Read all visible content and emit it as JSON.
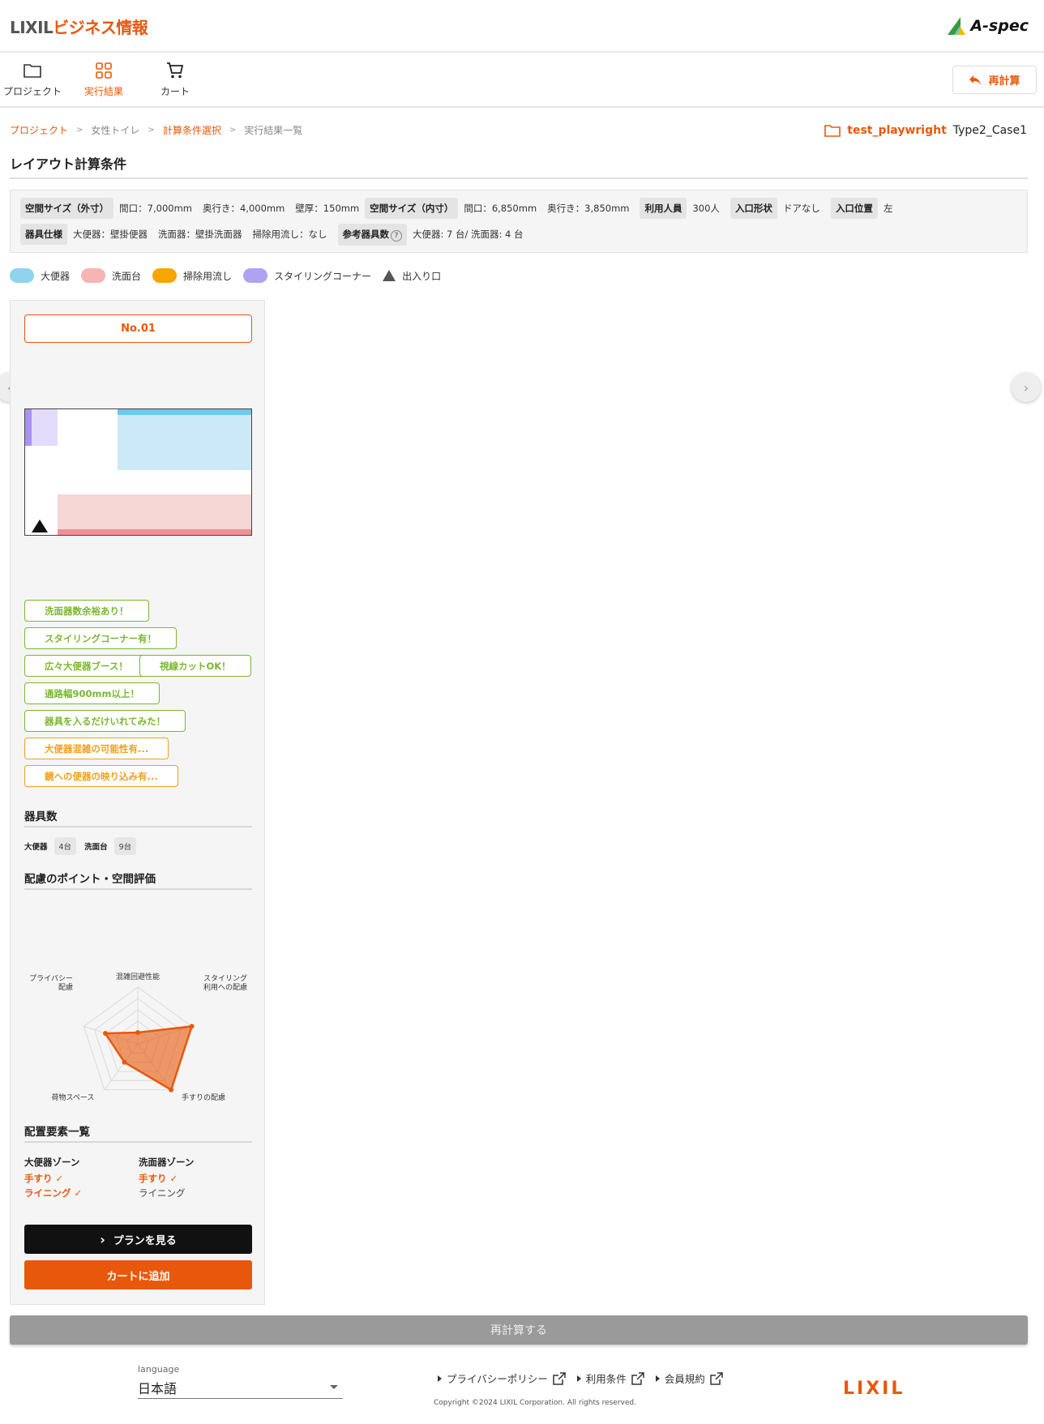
{
  "header": {
    "brand_lixil": "LIXIL",
    "brand_biz": "ビジネス情報",
    "aspec": "A-spec"
  },
  "nav": {
    "items": [
      {
        "label": "プロジェクト",
        "icon": "folder-icon"
      },
      {
        "label": "実行結果",
        "icon": "grid-icon",
        "active": true
      },
      {
        "label": "カート",
        "icon": "cart-icon"
      }
    ],
    "recalc_label": "再計算"
  },
  "breadcrumb": {
    "items": [
      "プロジェクト",
      "女性トイレ",
      "計算条件選択",
      "実行結果一覧"
    ],
    "separator": ">"
  },
  "project": {
    "name": "test_playwright",
    "case": "Type2_Case1"
  },
  "page_title": "レイアウト計算条件",
  "conditions": {
    "outer_label": "空間サイズ（外寸）",
    "outer_width": "間口：7,000mm",
    "outer_depth": "奥行き：4,000mm",
    "wall": "壁厚：150mm",
    "inner_label": "空間サイズ（内寸）",
    "inner_width": "間口：6,850mm",
    "inner_depth": "奥行き：3,850mm",
    "users_label": "利用人員",
    "users_value": "300人",
    "entrance_shape_label": "入口形状",
    "entrance_shape_value": "ドアなし",
    "entrance_pos_label": "入口位置",
    "entrance_pos_value": "左",
    "spec_label": "器具仕様",
    "spec_toilet": "大便器：壁掛便器",
    "spec_basin": "洗面器：壁掛洗面器",
    "spec_sink": "掃除用流し：なし",
    "ref_label": "参考器具数",
    "ref_value": "大便器: 7 台/ 洗面器: 4 台"
  },
  "legend": [
    {
      "label": "大便器",
      "color": "#8fd3ee"
    },
    {
      "label": "洗面台",
      "color": "#f7b4b4"
    },
    {
      "label": "掃除用流し",
      "color": "#f7a500"
    },
    {
      "label": "スタイリングコーナー",
      "color": "#b0a2f2"
    },
    {
      "label": "出入り口",
      "color": "#555555"
    }
  ],
  "result": {
    "no": "No.01",
    "tags": [
      {
        "label": "洗面器数余裕あり！",
        "type": "good"
      },
      {
        "label": "スタイリングコーナー有！",
        "type": "good"
      },
      {
        "label": "広々大便器ブース！",
        "type": "good"
      },
      {
        "label": "視線カットOK！",
        "type": "good"
      },
      {
        "label": "通路幅900mm以上！",
        "type": "good"
      },
      {
        "label": "器具を入るだけいれてみた！",
        "type": "good"
      },
      {
        "label": "大便器混雑の可能性有...",
        "type": "warn"
      },
      {
        "label": "鏡への便器の映り込み有...",
        "type": "warn"
      }
    ],
    "counts_title": "器具数",
    "counts": {
      "toilet_label": "大便器",
      "toilet_value": "4台",
      "basin_label": "洗面台",
      "basin_value": "9台"
    },
    "eval_title": "配慮のポイント・空間評価",
    "radar": {
      "labels": [
        "混雑回避性能",
        "スタイリング利用への配慮",
        "手すりの配慮",
        "荷物スペース",
        "プライバシー配慮"
      ],
      "label_lines": [
        [
          "混雑回避性能"
        ],
        [
          "スタイリング",
          "利用への配慮"
        ],
        [
          "手すりの配慮"
        ],
        [
          "荷物スペース"
        ],
        [
          "プライバシー",
          "配慮"
        ]
      ],
      "values": [
        0.2,
        1.0,
        1.0,
        0.4,
        0.6
      ],
      "levels": 5,
      "color": "#e8580c"
    },
    "elements_title": "配置要素一覧",
    "zones": [
      {
        "title": "大便器ゾーン",
        "items": [
          {
            "label": "手すり ✓",
            "on": true
          },
          {
            "label": "ライニング ✓",
            "on": true
          }
        ]
      },
      {
        "title": "洗面器ゾーン",
        "items": [
          {
            "label": "手すり ✓",
            "on": true
          },
          {
            "label": "ライニング",
            "on": false
          }
        ]
      }
    ],
    "plan_button": "プランを見る",
    "cart_button": "カートに追加"
  },
  "recalc_run": "再計算する",
  "footer": {
    "language_label": "language",
    "language_value": "日本語",
    "links": [
      "プライバシーポリシー",
      "利用条件",
      "会員規約"
    ],
    "copyright": "Copyright ©2024 LIXIL Corporation. All rights reserved.",
    "logo": "LIXIL"
  }
}
